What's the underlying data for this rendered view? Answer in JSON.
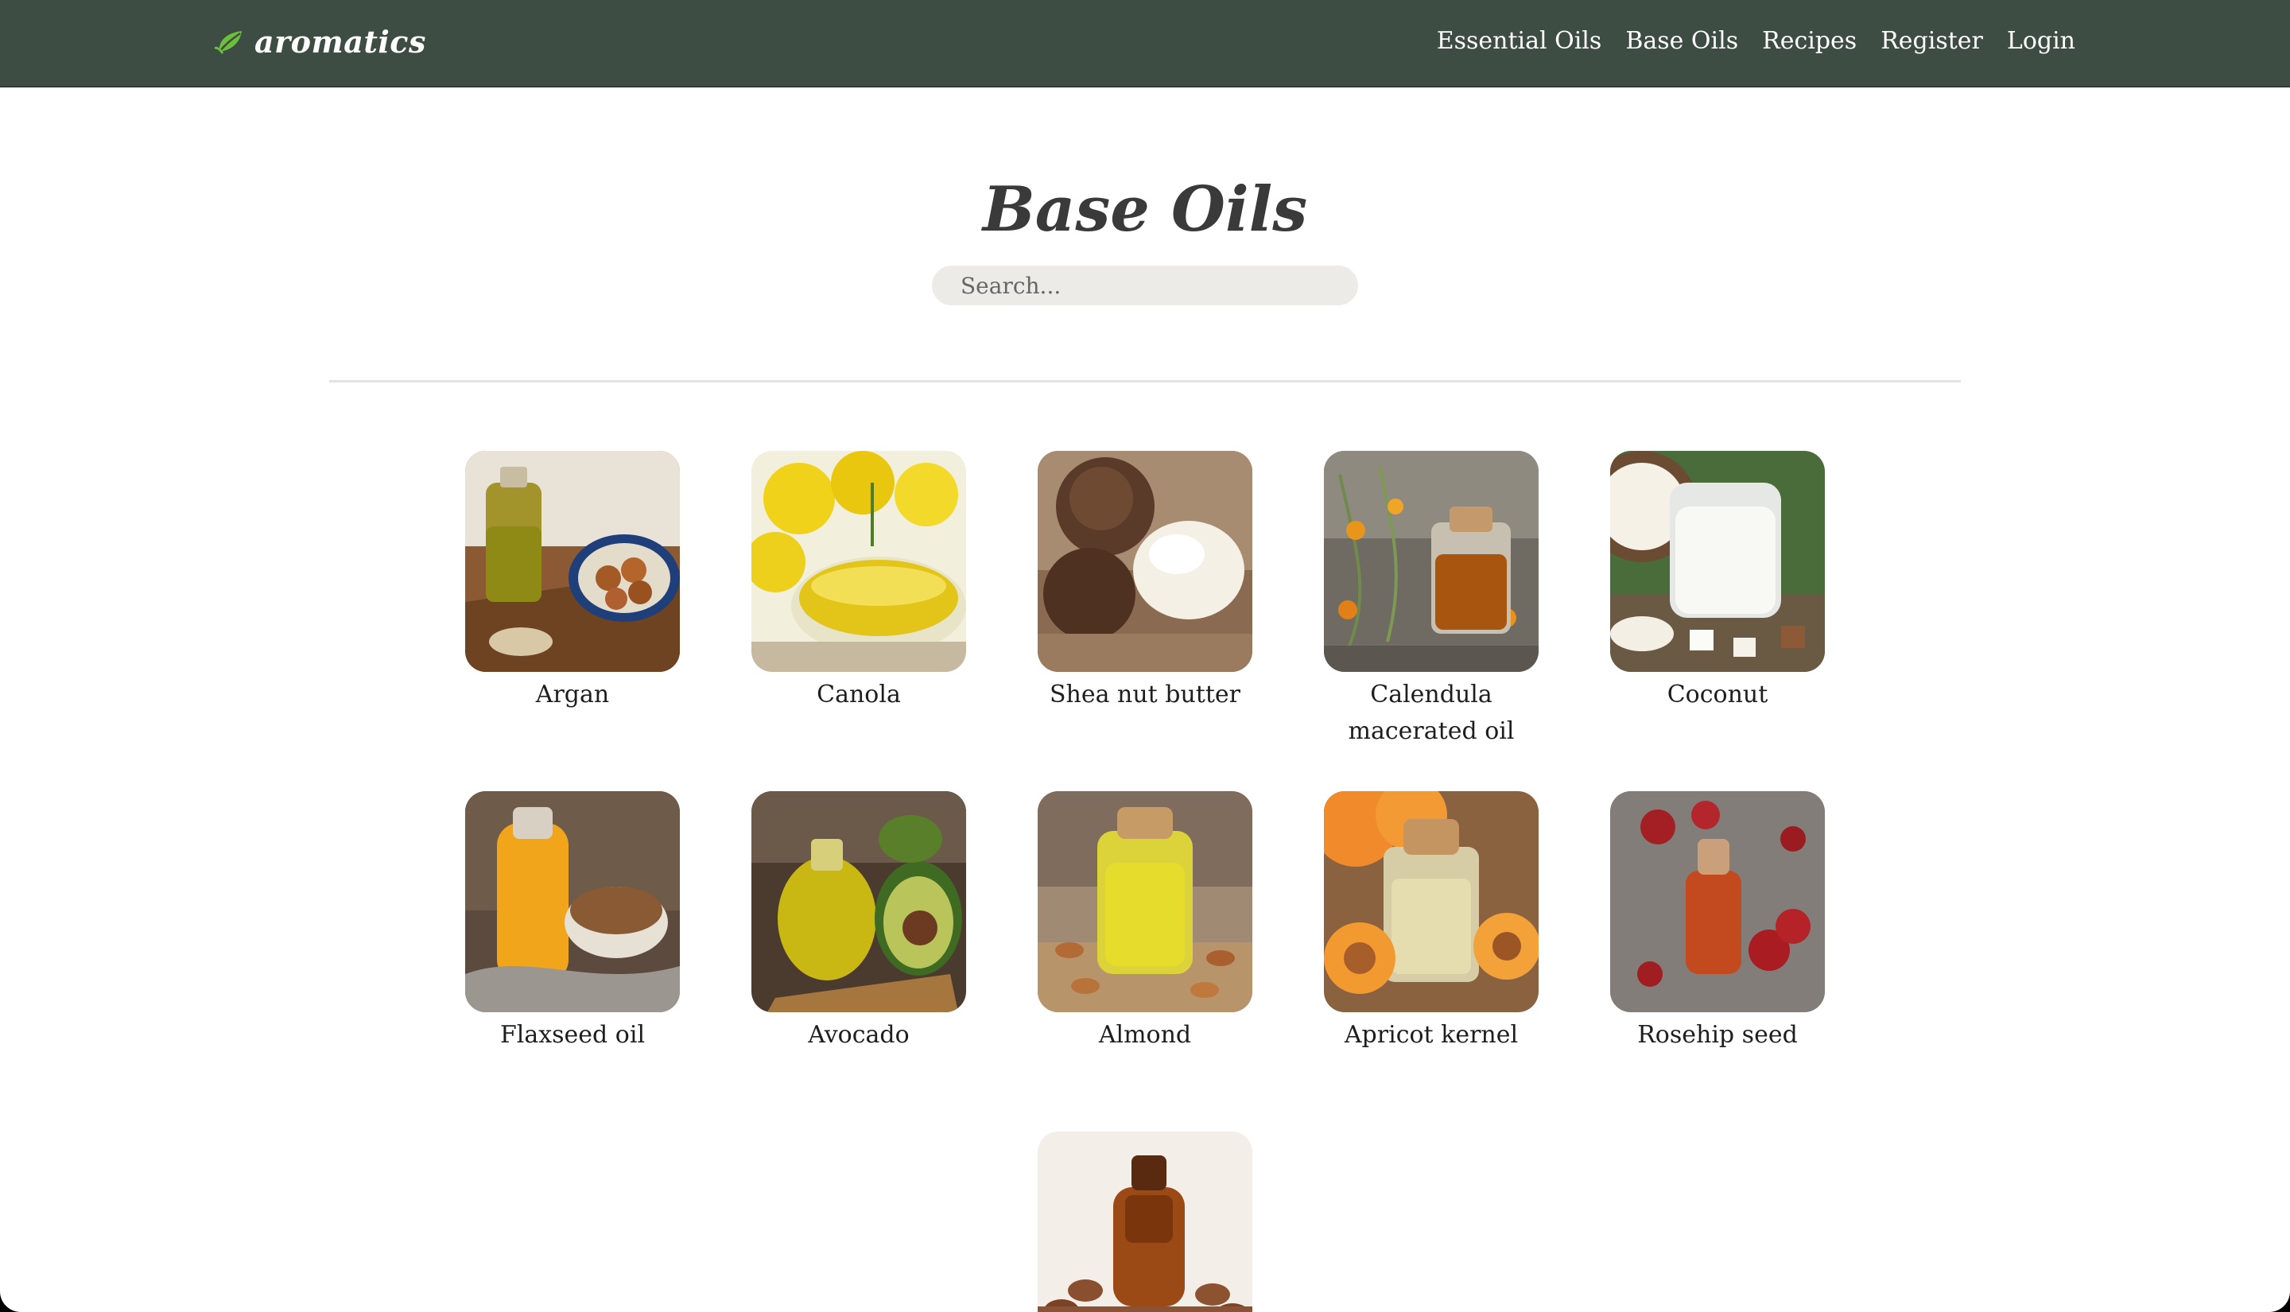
{
  "brand": {
    "name": "aromatics",
    "icon": "leaf-icon"
  },
  "nav": {
    "items": [
      "Essential Oils",
      "Base Oils",
      "Recipes",
      "Register",
      "Login"
    ]
  },
  "page": {
    "title": "Base Oils",
    "search_placeholder": "Search..."
  },
  "oils": [
    {
      "name": "Argan"
    },
    {
      "name": "Canola"
    },
    {
      "name": "Shea nut butter"
    },
    {
      "name": "Calendula macerated oil"
    },
    {
      "name": "Coconut"
    },
    {
      "name": "Flaxseed oil"
    },
    {
      "name": "Avocado"
    },
    {
      "name": "Almond"
    },
    {
      "name": "Apricot kernel"
    },
    {
      "name": "Rosehip seed"
    },
    {
      "name": ""
    }
  ],
  "colors": {
    "navbar": "#3e4d43",
    "accent_leaf": "#6bbf3a",
    "search_bg": "#edebe7"
  }
}
